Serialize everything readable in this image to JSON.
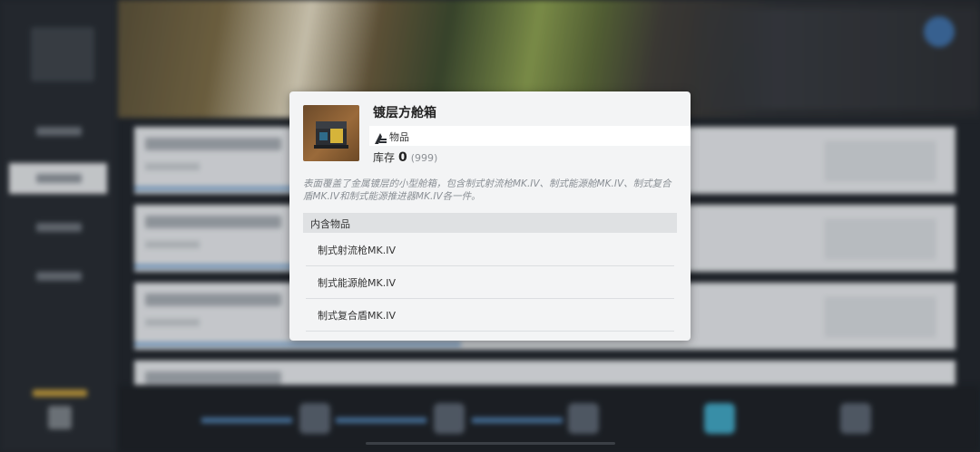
{
  "modal": {
    "title": "镀层方舱箱",
    "type_label": "物品",
    "stock_label": "库存",
    "stock_value": "0",
    "stock_max": "(999)",
    "description": "表面覆盖了金属镀层的小型舱箱，包含制式射流枪MK.IV、制式能源舱MK.IV、制式复合盾MK.IV和制式能源推进器MK.IV各一件。",
    "contents_header": "内含物品",
    "contents": [
      {
        "name": "制式射流枪MK.IV"
      },
      {
        "name": "制式能源舱MK.IV"
      },
      {
        "name": "制式复合盾MK.IV"
      }
    ]
  },
  "colors": {
    "accent_blue": "#4f7fb0",
    "close_button": "#3d6ea6",
    "item_frame_brown": "#9a6a3a"
  },
  "icons": [
    "item-box-icon",
    "item-type-icon",
    "close-icon"
  ]
}
